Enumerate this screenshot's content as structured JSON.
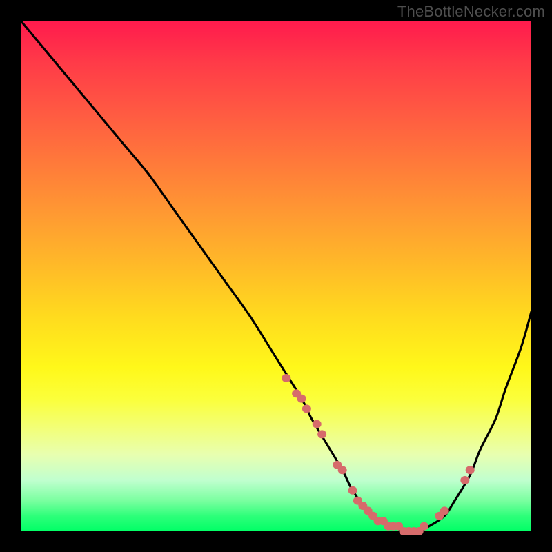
{
  "watermark": "TheBottleNecker.com",
  "colors": {
    "background": "#000000",
    "curve": "#000000",
    "points": "#d66b6b",
    "gradient_top": "#ff1a4d",
    "gradient_bottom": "#00ff66"
  },
  "chart_data": {
    "type": "line",
    "title": "",
    "xlabel": "",
    "ylabel": "",
    "xlim": [
      0,
      100
    ],
    "ylim": [
      0,
      100
    ],
    "grid": false,
    "legend": false,
    "annotations": [
      "TheBottleNecker.com"
    ],
    "series": [
      {
        "name": "bottleneck-curve",
        "x": [
          0,
          5,
          10,
          15,
          20,
          25,
          30,
          35,
          40,
          45,
          50,
          55,
          57,
          60,
          63,
          65,
          68,
          70,
          73,
          75,
          78,
          80,
          83,
          85,
          88,
          90,
          93,
          95,
          98,
          100
        ],
        "y": [
          100,
          94,
          88,
          82,
          76,
          70,
          63,
          56,
          49,
          42,
          34,
          26,
          22,
          17,
          12,
          8,
          4,
          2,
          1,
          0,
          0,
          1,
          3,
          6,
          11,
          16,
          22,
          28,
          36,
          43
        ]
      }
    ],
    "scatter_points": {
      "name": "highlighted-points",
      "x": [
        52,
        54,
        55,
        56,
        58,
        59,
        62,
        63,
        65,
        66,
        67,
        68,
        69,
        70,
        71,
        72,
        73,
        74,
        75,
        76,
        77,
        78,
        79,
        82,
        83,
        87,
        88
      ],
      "y": [
        30,
        27,
        26,
        24,
        21,
        19,
        13,
        12,
        8,
        6,
        5,
        4,
        3,
        2,
        2,
        1,
        1,
        1,
        0,
        0,
        0,
        0,
        1,
        3,
        4,
        10,
        12
      ]
    }
  }
}
